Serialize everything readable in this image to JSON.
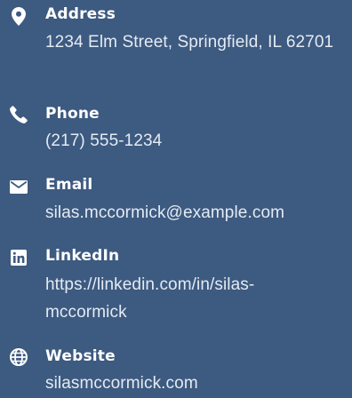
{
  "contacts": {
    "address": {
      "icon": "map-marker-icon",
      "label": "Address",
      "value": "1234 Elm Street, Springfield, IL 62701"
    },
    "phone": {
      "icon": "phone-icon",
      "label": "Phone",
      "value": "(217) 555-1234"
    },
    "email": {
      "icon": "envelope-icon",
      "label": "Email",
      "value": "silas.mccormick@example.com"
    },
    "linkedin": {
      "icon": "linkedin-icon",
      "label": "LinkedIn",
      "value": "https://linkedin.com/in/silas-mccormick"
    },
    "website": {
      "icon": "globe-icon",
      "label": "Website",
      "value": "silasmccormick.com"
    }
  },
  "colors": {
    "background": "#3d5a80",
    "label": "#ffffff",
    "value": "#e4ebf3"
  }
}
